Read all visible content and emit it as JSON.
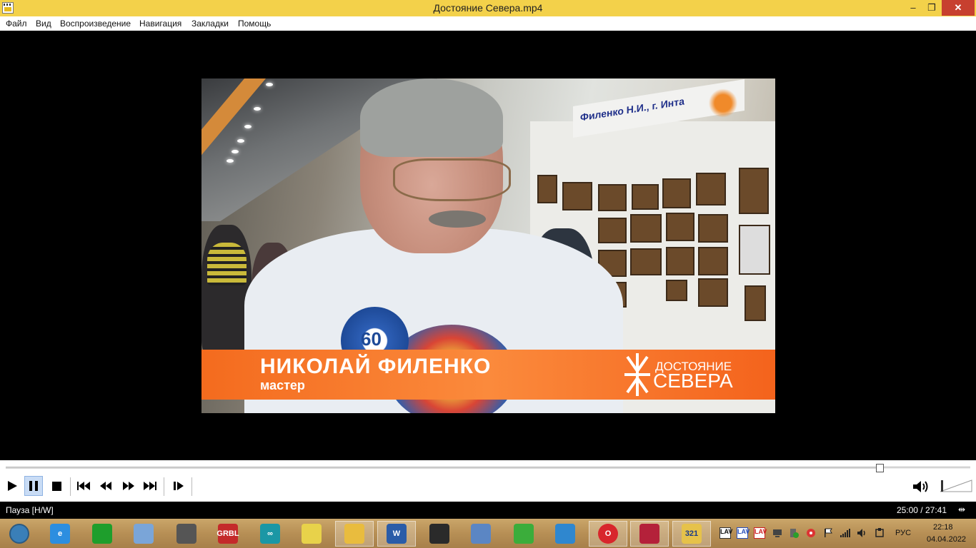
{
  "window": {
    "title": "Достояние Севера.mp4",
    "min_glyph": "–",
    "max_glyph": "❐",
    "close_glyph": "✕"
  },
  "menu": {
    "items": [
      "Файл",
      "Вид",
      "Воспроизведение",
      "Навигация",
      "Закладки",
      "Помощь"
    ]
  },
  "video": {
    "booth_sign": "Филенко Н.И., г. Инта",
    "badge_number": "60",
    "lower_third_name": "НИКОЛАЙ ФИЛЕНКО",
    "lower_third_role": "мастер",
    "lower_third_logo_line1": "ДОСТОЯНИЕ",
    "lower_third_logo_line2": "СЕВЕРА"
  },
  "playback": {
    "position_fraction": 0.906,
    "state": "paused",
    "volume_fraction": 1.0
  },
  "controls": {
    "buttons": [
      "play-icon",
      "pause-icon",
      "stop-icon",
      "previous-icon",
      "rewind-icon",
      "fast-forward-icon",
      "next-icon",
      "frame-step-icon"
    ],
    "volume_icon": "speaker-icon"
  },
  "status": {
    "text": "Пауза [H/W]",
    "time": "25:00 / 27:41",
    "right_icon": "⇹"
  },
  "taskbar": {
    "apps": [
      {
        "name": "start-orb-icon",
        "label": "",
        "color": "#3a7fb8"
      },
      {
        "name": "internet-explorer-icon",
        "label": "e",
        "color": "#2c8ee0"
      },
      {
        "name": "green-tool-icon",
        "label": "",
        "color": "#1e9e2c"
      },
      {
        "name": "paint-palette-icon",
        "label": "",
        "color": "#7aa5d8"
      },
      {
        "name": "tool-icon",
        "label": "",
        "color": "#555555"
      },
      {
        "name": "grbl-laser-icon",
        "label": "GRBL",
        "color": "#c42a2a"
      },
      {
        "name": "arduino-icon",
        "label": "∞",
        "color": "#1b97a5"
      },
      {
        "name": "chart-app-icon",
        "label": "",
        "color": "#e8d24a"
      },
      {
        "name": "file-explorer-icon",
        "label": "",
        "color": "#e9bc3e"
      },
      {
        "name": "word-icon",
        "label": "W",
        "color": "#2a5ca8"
      },
      {
        "name": "inkscape-icon",
        "label": "",
        "color": "#2a2a2a"
      },
      {
        "name": "calculator-icon",
        "label": "",
        "color": "#5b86c4"
      },
      {
        "name": "green-check-app-icon",
        "label": "",
        "color": "#3bad3b"
      },
      {
        "name": "monitor-icon",
        "label": "",
        "color": "#2f87cf"
      },
      {
        "name": "opera-icon",
        "label": "O",
        "color": "#d8262c"
      },
      {
        "name": "screen-recorder-icon",
        "label": "",
        "color": "#b4213a"
      },
      {
        "name": "media-player-classic-icon",
        "label": "321",
        "color": "#e6c24a"
      }
    ],
    "tray": [
      "LAV",
      "LAV",
      "LAV",
      "",
      "",
      "",
      "",
      "",
      "",
      ""
    ],
    "language": "РУС",
    "clock_time": "22:18",
    "clock_date": "04.04.2022"
  }
}
